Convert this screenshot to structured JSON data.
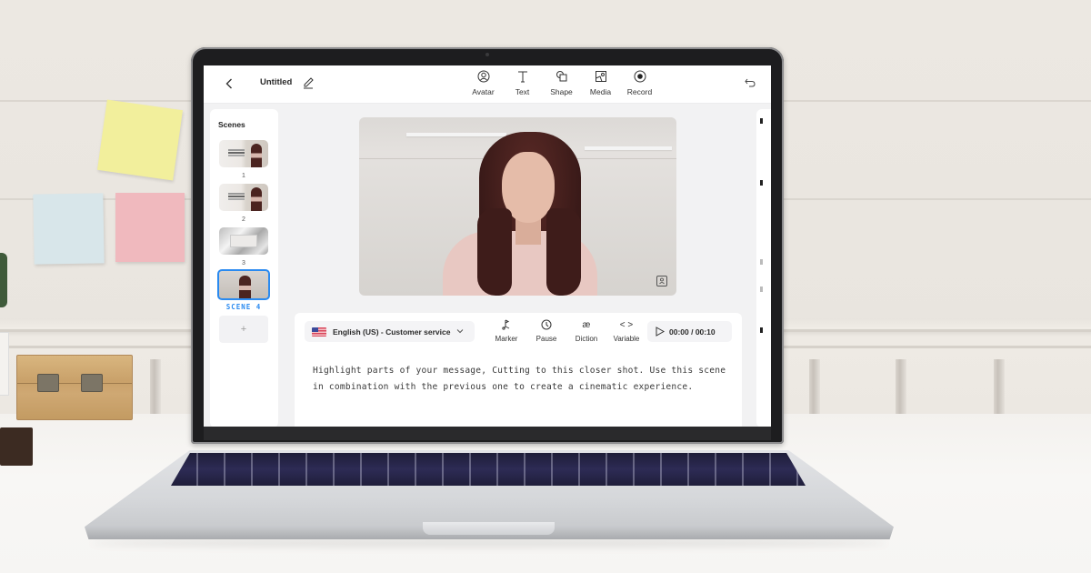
{
  "app": {
    "title": "Untitled",
    "toolbar": {
      "back_icon": "chevron-left-icon",
      "edit_icon": "pencil-icon",
      "tools": [
        {
          "label": "Avatar",
          "icon": "avatar-icon"
        },
        {
          "label": "Text",
          "icon": "text-icon"
        },
        {
          "label": "Shape",
          "icon": "shape-icon"
        },
        {
          "label": "Media",
          "icon": "media-icon"
        },
        {
          "label": "Record",
          "icon": "record-icon"
        }
      ],
      "undo_icon": "undo-icon"
    },
    "scenes": {
      "title": "Scenes",
      "items": [
        {
          "number": "1"
        },
        {
          "number": "2"
        },
        {
          "number": "3"
        },
        {
          "number": "SCENE 4",
          "active": true
        }
      ],
      "add_label": "+",
      "active_color": "#2A8AF0"
    },
    "preview": {
      "watermark_icon": "avatar-badge-icon"
    },
    "script": {
      "language": "English (US) - Customer service",
      "language_flag": "us-flag-icon",
      "tools": [
        {
          "label": "Marker",
          "icon": "marker-icon"
        },
        {
          "label": "Pause",
          "icon": "clock-icon"
        },
        {
          "label": "Diction",
          "icon": "ae-ligature-icon",
          "glyph": "æ"
        },
        {
          "label": "Variable",
          "icon": "code-brackets-icon",
          "glyph": "< >"
        }
      ],
      "playback": "00:00 / 00:10",
      "text": "Highlight parts of your message, Cutting to this closer shot. Use this scene in combination with the previous one to create a cinematic experience."
    }
  }
}
